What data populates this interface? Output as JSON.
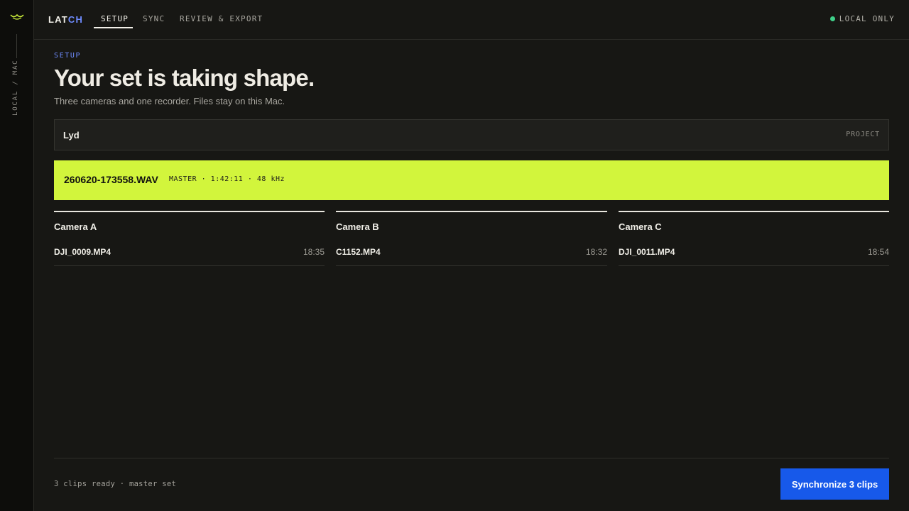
{
  "rail": {
    "logo_icon": "wave-icon",
    "label": "LOCAL / MAC",
    "accent_color": "#d2f53c"
  },
  "header": {
    "brand_prefix": "LAT",
    "brand_suffix": "CH",
    "tabs": [
      {
        "label": "SETUP",
        "active": true
      },
      {
        "label": "SYNC",
        "active": false
      },
      {
        "label": "REVIEW & EXPORT",
        "active": false
      }
    ],
    "status_label": "LOCAL ONLY",
    "status_color": "#3fd08a"
  },
  "main": {
    "eyebrow": "SETUP",
    "title": "Your set is taking shape.",
    "subtitle": "Three cameras and one recorder. Files stay on this Mac.",
    "project": {
      "name": "Lyd",
      "tag": "PROJECT"
    },
    "master": {
      "file": "260620-173558.WAV",
      "meta": "MASTER · 1:42:11 · 48 kHz",
      "color": "#d2f53c"
    },
    "cameras": [
      {
        "title": "Camera A",
        "clip": "DJI_0009.MP4",
        "duration": "18:35"
      },
      {
        "title": "Camera B",
        "clip": "C1152.MP4",
        "duration": "18:32"
      },
      {
        "title": "Camera C",
        "clip": "DJI_0011.MP4",
        "duration": "18:54"
      }
    ]
  },
  "footer": {
    "status": "3 clips ready · master set",
    "button_label": "Synchronize 3 clips",
    "button_color": "#1759ea"
  }
}
